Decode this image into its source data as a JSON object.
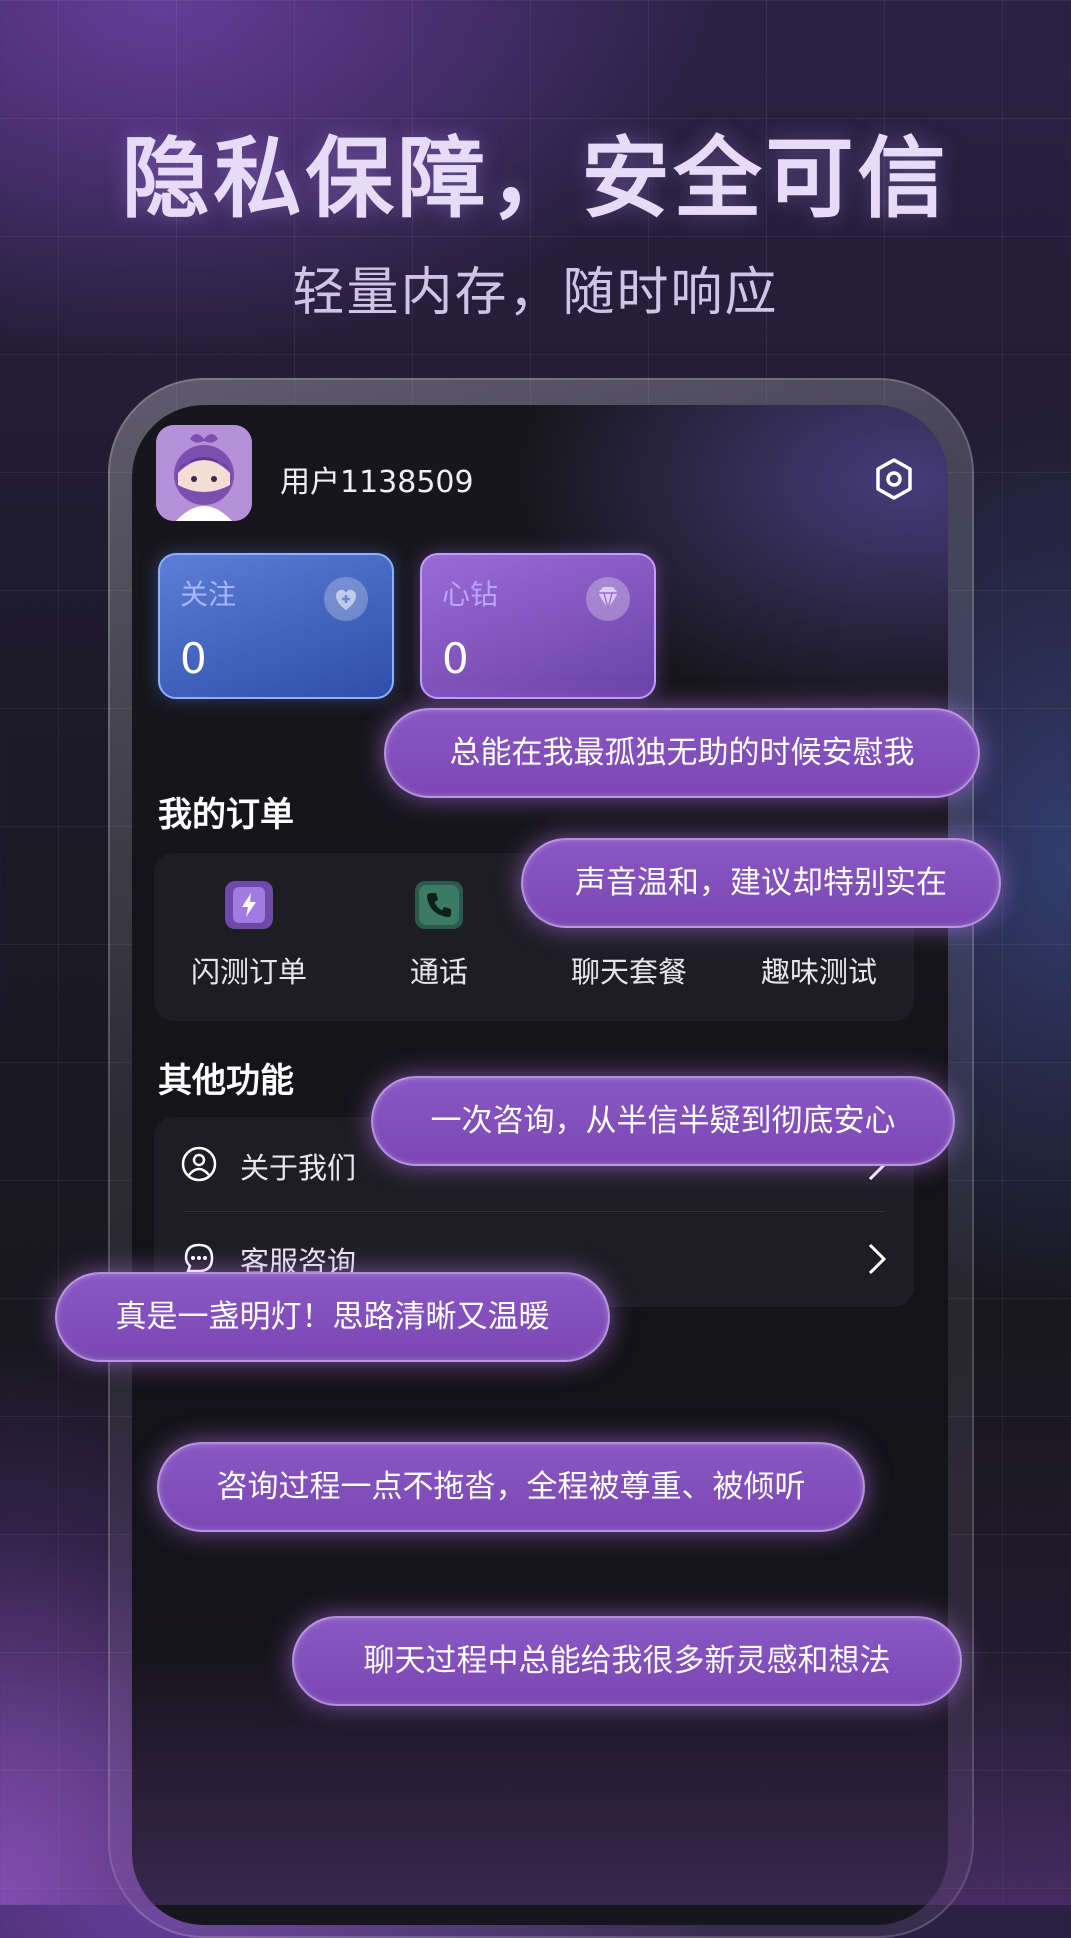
{
  "headline": "隐私保障，安全可信",
  "subheadline": "轻量内存，随时响应",
  "profile": {
    "username": "用户1138509"
  },
  "stats": {
    "follow": {
      "label": "关注",
      "value": "0",
      "icon": "heart-plus-icon"
    },
    "diamond": {
      "label": "心钻",
      "value": "0",
      "icon": "diamond-icon"
    }
  },
  "orders": {
    "title": "我的订单",
    "items": [
      {
        "label": "闪测订单",
        "icon": "flash-order-icon"
      },
      {
        "label": "通话",
        "icon": "phone-icon"
      },
      {
        "label": "聊天套餐",
        "icon": "chat-package-icon"
      },
      {
        "label": "趣味测试",
        "icon": "fun-test-icon"
      }
    ]
  },
  "other": {
    "title": "其他功能",
    "items": [
      {
        "label": "关于我们",
        "icon": "user-circle-icon"
      },
      {
        "label": "客服咨询",
        "icon": "customer-service-icon"
      }
    ]
  },
  "reviews": [
    "总能在我最孤独无助的时候安慰我",
    "声音温和，建议却特别实在",
    "一次咨询，从半信半疑到彻底安心",
    "真是一盏明灯！思路清晰又温暖",
    "咨询过程一点不拖沓，全程被尊重、被倾听",
    "聊天过程中总能给我很多新灵感和想法"
  ],
  "colors": {
    "accent_purple": "#8a58c4",
    "follow_card": "#3f63bf",
    "diamond_card": "#8455c2",
    "phone_screen": "#151419"
  }
}
